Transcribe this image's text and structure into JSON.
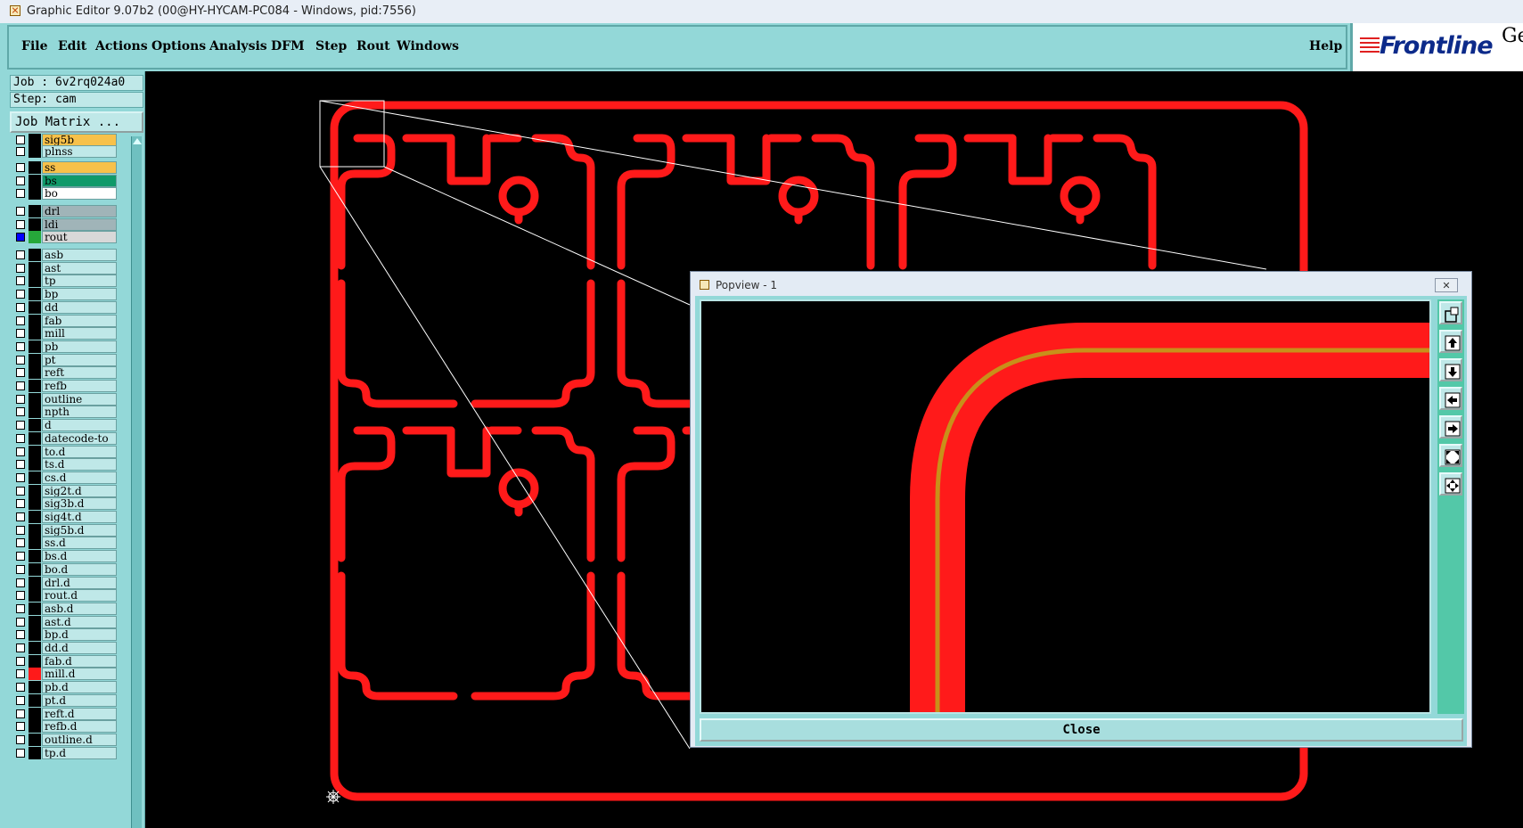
{
  "window": {
    "title": "Graphic Editor 9.07b2 (00@HY-HYCAM-PC084 - Windows, pid:7556)"
  },
  "menu": {
    "items": [
      "File",
      "Edit",
      "Actions",
      "Options",
      "Analysis",
      "DFM",
      "Step",
      "Rout",
      "Windows"
    ],
    "help": "Help"
  },
  "logo": {
    "text": "Frontline",
    "corner_text": "Ge"
  },
  "job": {
    "job_line": "Job : 6v2rq024a0",
    "step_line": "Step: cam",
    "matrix_button": "Job Matrix ..."
  },
  "layers": [
    {
      "name": "sig5b",
      "color": "#f7c14a",
      "active": false,
      "swatch": ""
    },
    {
      "name": "plnss",
      "color": "#bfe8e8",
      "active": false,
      "swatch": ""
    },
    {
      "name": "ss",
      "color": "#f7c14a",
      "active": false,
      "swatch": ""
    },
    {
      "name": "bs",
      "color": "#0f9a6a",
      "active": false,
      "swatch": ""
    },
    {
      "name": "bo",
      "color": "#ffffff",
      "active": false,
      "swatch": ""
    },
    {
      "name": "drl",
      "color": "#a0b4b8",
      "active": false,
      "swatch": ""
    },
    {
      "name": "ldi",
      "color": "#a0b4b8",
      "active": false,
      "swatch": ""
    },
    {
      "name": "rout",
      "color": "#d8d8d8",
      "active": true,
      "swatch": "#26a83a"
    },
    {
      "name": "asb",
      "color": "#bfe8e8",
      "active": false,
      "swatch": ""
    },
    {
      "name": "ast",
      "color": "#bfe8e8",
      "active": false,
      "swatch": ""
    },
    {
      "name": "tp",
      "color": "#bfe8e8",
      "active": false,
      "swatch": ""
    },
    {
      "name": "bp",
      "color": "#bfe8e8",
      "active": false,
      "swatch": ""
    },
    {
      "name": "dd",
      "color": "#bfe8e8",
      "active": false,
      "swatch": ""
    },
    {
      "name": "fab",
      "color": "#bfe8e8",
      "active": false,
      "swatch": ""
    },
    {
      "name": "mill",
      "color": "#bfe8e8",
      "active": false,
      "swatch": ""
    },
    {
      "name": "pb",
      "color": "#bfe8e8",
      "active": false,
      "swatch": ""
    },
    {
      "name": "pt",
      "color": "#bfe8e8",
      "active": false,
      "swatch": ""
    },
    {
      "name": "reft",
      "color": "#bfe8e8",
      "active": false,
      "swatch": ""
    },
    {
      "name": "refb",
      "color": "#bfe8e8",
      "active": false,
      "swatch": ""
    },
    {
      "name": "outline",
      "color": "#bfe8e8",
      "active": false,
      "swatch": ""
    },
    {
      "name": "npth",
      "color": "#bfe8e8",
      "active": false,
      "swatch": ""
    },
    {
      "name": "d",
      "color": "#bfe8e8",
      "active": false,
      "swatch": ""
    },
    {
      "name": "datecode-to",
      "color": "#bfe8e8",
      "active": false,
      "swatch": ""
    },
    {
      "name": "to.d",
      "color": "#bfe8e8",
      "active": false,
      "swatch": ""
    },
    {
      "name": "ts.d",
      "color": "#bfe8e8",
      "active": false,
      "swatch": ""
    },
    {
      "name": "cs.d",
      "color": "#bfe8e8",
      "active": false,
      "swatch": ""
    },
    {
      "name": "sig2t.d",
      "color": "#bfe8e8",
      "active": false,
      "swatch": ""
    },
    {
      "name": "sig3b.d",
      "color": "#bfe8e8",
      "active": false,
      "swatch": ""
    },
    {
      "name": "sig4t.d",
      "color": "#bfe8e8",
      "active": false,
      "swatch": ""
    },
    {
      "name": "sig5b.d",
      "color": "#bfe8e8",
      "active": false,
      "swatch": ""
    },
    {
      "name": "ss.d",
      "color": "#bfe8e8",
      "active": false,
      "swatch": ""
    },
    {
      "name": "bs.d",
      "color": "#bfe8e8",
      "active": false,
      "swatch": ""
    },
    {
      "name": "bo.d",
      "color": "#bfe8e8",
      "active": false,
      "swatch": ""
    },
    {
      "name": "drl.d",
      "color": "#bfe8e8",
      "active": false,
      "swatch": ""
    },
    {
      "name": "rout.d",
      "color": "#bfe8e8",
      "active": false,
      "swatch": ""
    },
    {
      "name": "asb.d",
      "color": "#bfe8e8",
      "active": false,
      "swatch": ""
    },
    {
      "name": "ast.d",
      "color": "#bfe8e8",
      "active": false,
      "swatch": ""
    },
    {
      "name": "bp.d",
      "color": "#bfe8e8",
      "active": false,
      "swatch": ""
    },
    {
      "name": "dd.d",
      "color": "#bfe8e8",
      "active": false,
      "swatch": ""
    },
    {
      "name": "fab.d",
      "color": "#bfe8e8",
      "active": false,
      "swatch": ""
    },
    {
      "name": "mill.d",
      "color": "#bfe8e8",
      "active": false,
      "swatch": "#ff1a1a"
    },
    {
      "name": "pb.d",
      "color": "#bfe8e8",
      "active": false,
      "swatch": ""
    },
    {
      "name": "pt.d",
      "color": "#bfe8e8",
      "active": false,
      "swatch": ""
    },
    {
      "name": "reft.d",
      "color": "#bfe8e8",
      "active": false,
      "swatch": ""
    },
    {
      "name": "refb.d",
      "color": "#bfe8e8",
      "active": false,
      "swatch": ""
    },
    {
      "name": "outline.d",
      "color": "#bfe8e8",
      "active": false,
      "swatch": ""
    },
    {
      "name": "tp.d",
      "color": "#bfe8e8",
      "active": false,
      "swatch": ""
    }
  ],
  "popview": {
    "title": "Popview - 1",
    "close_label": "Close",
    "tools": [
      "zoom-home-icon",
      "pan-up-icon",
      "pan-down-icon",
      "pan-left-icon",
      "pan-right-icon",
      "zoom-in-icon",
      "zoom-out-icon"
    ]
  },
  "colors": {
    "rout": "#ff1a1a",
    "centerline": "#c8901a",
    "panel": "#93d8d8",
    "canvas": "#000000"
  }
}
